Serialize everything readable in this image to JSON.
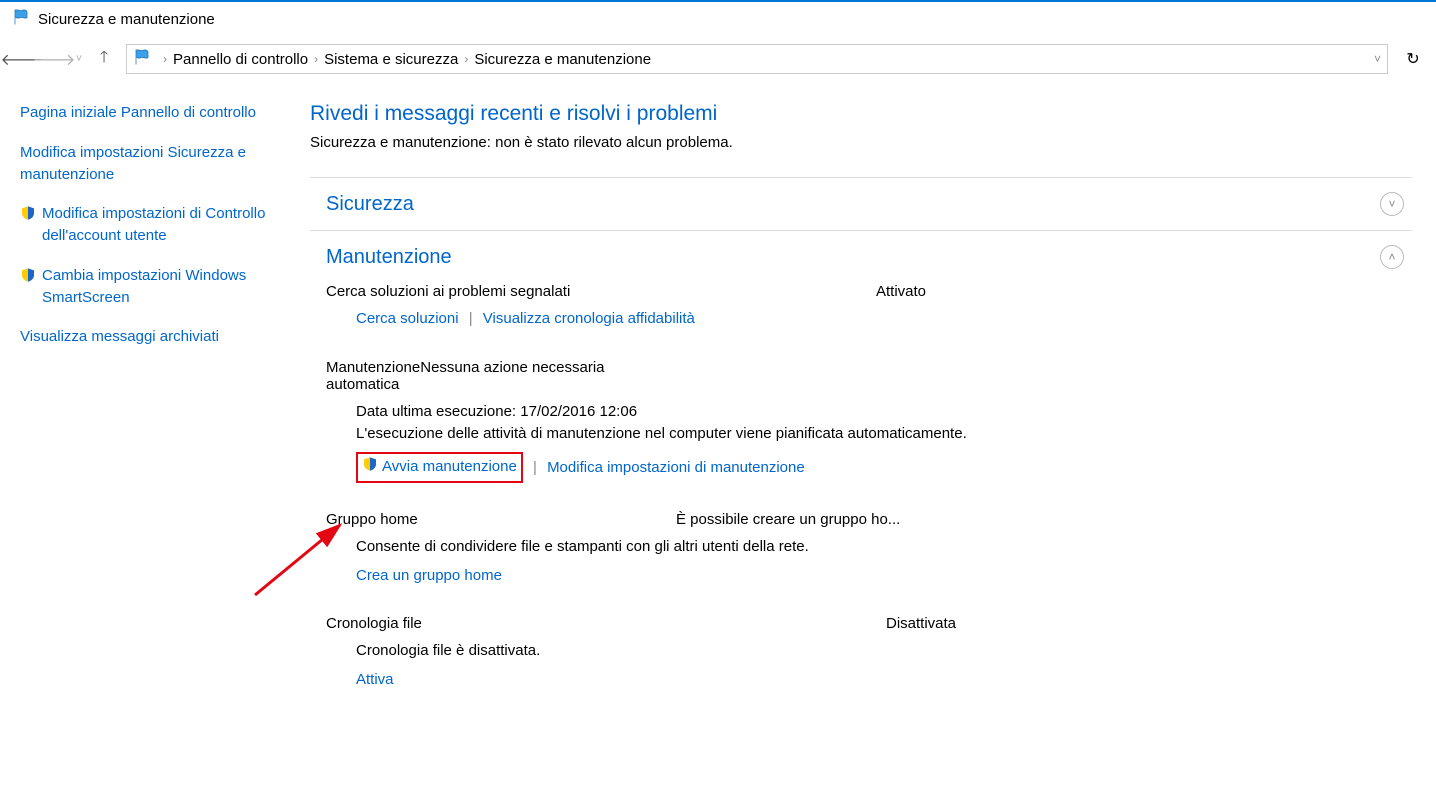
{
  "window": {
    "title": "Sicurezza e manutenzione"
  },
  "breadcrumb": {
    "items": [
      "Pannello di controllo",
      "Sistema e sicurezza",
      "Sicurezza e manutenzione"
    ]
  },
  "sidebar": {
    "links": [
      {
        "label": "Pagina iniziale Pannello di controllo",
        "shield": false
      },
      {
        "label": "Modifica impostazioni Sicurezza e manutenzione",
        "shield": false
      },
      {
        "label": "Modifica impostazioni di Controllo dell'account utente",
        "shield": true
      },
      {
        "label": "Cambia impostazioni Windows SmartScreen",
        "shield": true
      },
      {
        "label": "Visualizza messaggi archiviati",
        "shield": false
      }
    ]
  },
  "main": {
    "heading": "Rivedi i messaggi recenti e risolvi i problemi",
    "subheading": "Sicurezza e manutenzione: non è stato rilevato alcun problema.",
    "sections": {
      "security": {
        "title": "Sicurezza"
      },
      "maintenance": {
        "title": "Manutenzione",
        "problem_solutions": {
          "title": "Cerca soluzioni ai problemi segnalati",
          "status": "Attivato",
          "link_search": "Cerca soluzioni",
          "link_history": "Visualizza cronologia affidabilità"
        },
        "auto_maintenance": {
          "title": "Manutenzione automatica",
          "status": "Nessuna azione necessaria",
          "last_run_label": "Data ultima esecuzione: 17/02/2016 12:06",
          "desc": "L'esecuzione delle attività di manutenzione nel computer viene pianificata automaticamente.",
          "link_start": "Avvia manutenzione",
          "link_settings": "Modifica impostazioni di manutenzione"
        },
        "homegroup": {
          "title": "Gruppo home",
          "status": "È possibile creare un gruppo ho...",
          "desc": "Consente di condividere file e stampanti con gli altri utenti della rete.",
          "link_create": "Crea un gruppo home"
        },
        "file_history": {
          "title": "Cronologia file",
          "status": "Disattivata",
          "desc": "Cronologia file è disattivata.",
          "link_activate": "Attiva"
        }
      }
    }
  }
}
